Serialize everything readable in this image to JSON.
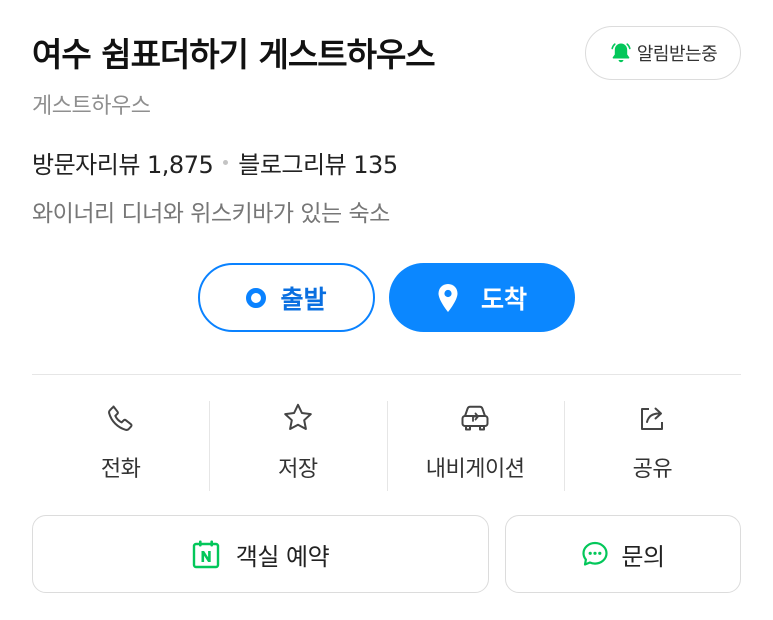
{
  "place": {
    "title": "여수 쉼표더하기 게스트하우스",
    "category": "게스트하우스",
    "visitor_reviews": "방문자리뷰 1,875",
    "blog_reviews": "블로그리뷰 135",
    "description": "와이너리 디너와 위스키바가 있는 숙소"
  },
  "alarm": {
    "label": "알림받는중",
    "icon": "bell-icon"
  },
  "route": {
    "depart_label": "출발",
    "arrive_label": "도착"
  },
  "actions": [
    {
      "label": "전화",
      "icon": "phone-icon"
    },
    {
      "label": "저장",
      "icon": "star-icon"
    },
    {
      "label": "내비게이션",
      "icon": "car-icon"
    },
    {
      "label": "공유",
      "icon": "share-icon"
    }
  ],
  "bottom": {
    "booking_label": "객실 예약",
    "inquiry_label": "문의"
  },
  "colors": {
    "accent": "#0b87ff",
    "naver_green": "#03c75a"
  }
}
